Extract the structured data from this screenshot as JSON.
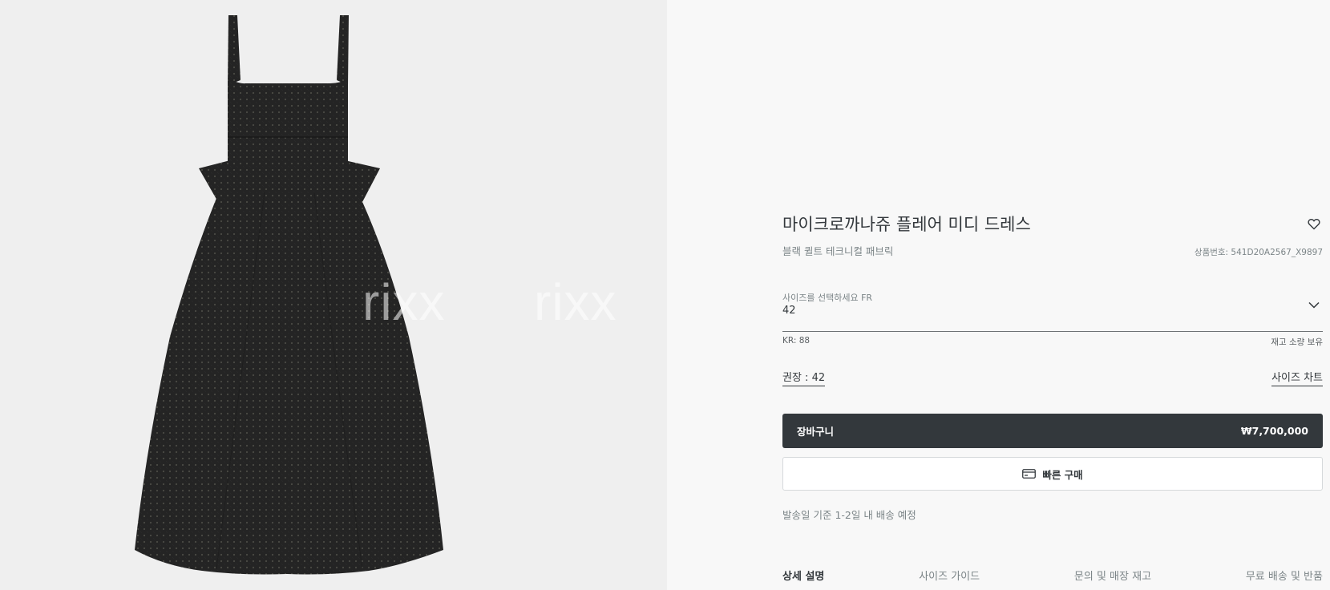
{
  "product": {
    "title": "마이크로까나쥬 플레어 미디 드레스",
    "subtitle": "블랙 퀼트 테크니컬 패브릭",
    "reference_text": "상품번호: 541D20A2567_X9897",
    "image_name": "dress-image"
  },
  "watermark": {
    "text": "rixx"
  },
  "size_select": {
    "label": "사이즈를 선택하세요 FR",
    "value": "42",
    "kr_size": "KR: 88",
    "stock": "재고 소량 보유"
  },
  "recommendation": {
    "text": "권장 : 42",
    "size_chart": "사이즈 차트"
  },
  "cart": {
    "label": "장바구니",
    "price": "₩7,700,000"
  },
  "quick_buy": {
    "label": "빠른 구매",
    "icon": "card-icon"
  },
  "delivery_note": "발송일 기준 1-2일 내 배송 예정",
  "tabs": [
    {
      "label": "상세 설명",
      "active": true
    },
    {
      "label": "사이즈 가이드",
      "active": false
    },
    {
      "label": "문의 및 매장 재고",
      "active": false
    },
    {
      "label": "무료 배송 및 반품",
      "active": false
    }
  ],
  "colors": {
    "dark": "#33383c",
    "muted": "#7b8487",
    "background": "#f8f8f8",
    "image_background": "#efefef",
    "dress": "#232323"
  }
}
